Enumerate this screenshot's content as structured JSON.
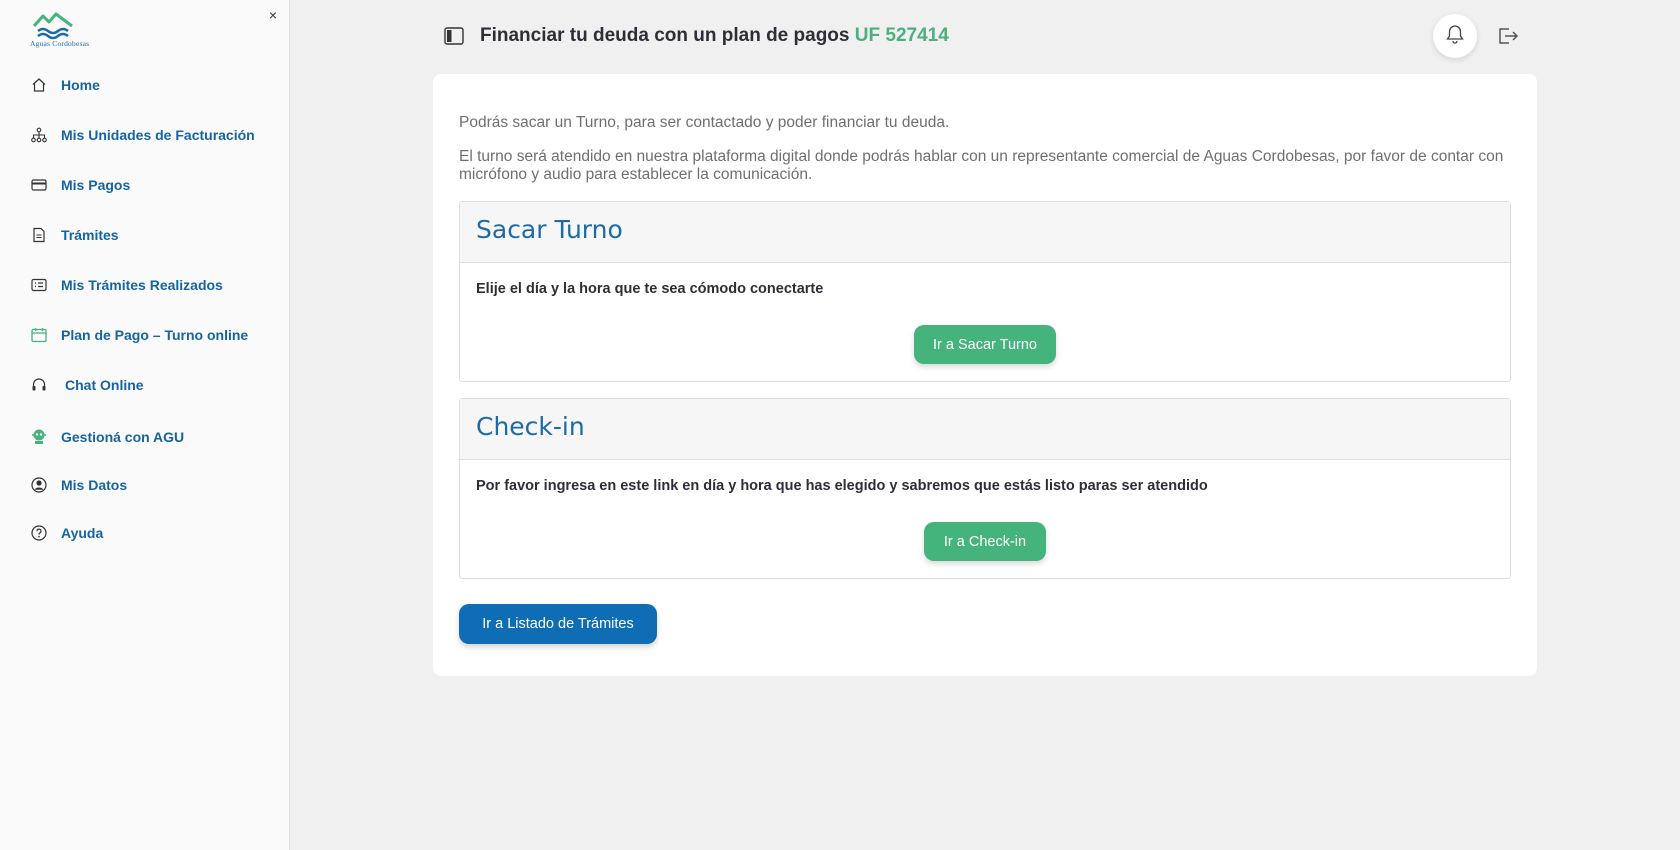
{
  "brand": {
    "logo_text": "Aguas Cordobesas",
    "accent": "#4caf7c",
    "primary": "#1665a0"
  },
  "sidebar": {
    "close_label": "×",
    "items": [
      {
        "label": "Home",
        "icon": "home-icon"
      },
      {
        "label": "Mis Unidades de Facturación",
        "icon": "sitemap-icon"
      },
      {
        "label": "Mis Pagos",
        "icon": "credit-card-icon"
      },
      {
        "label": "Trámites",
        "icon": "document-icon"
      },
      {
        "label": "Mis Trámites Realizados",
        "icon": "list-card-icon"
      },
      {
        "label": "Plan de Pago – Turno online",
        "icon": "calendar-icon"
      },
      {
        "label": "Chat Online",
        "icon": "headset-icon"
      },
      {
        "label": "Gestioná con AGU",
        "icon": "robot-icon"
      },
      {
        "label": "Mis Datos",
        "icon": "user-circle-icon"
      },
      {
        "label": "Ayuda",
        "icon": "help-circle-icon"
      }
    ]
  },
  "header": {
    "title": "Financiar tu deuda con un plan de pagos",
    "uf": "UF 527414"
  },
  "main": {
    "intro1": "Podrás sacar un Turno, para ser contactado y poder financiar tu deuda.",
    "intro2": "El turno será atendido en nuestra plataforma digital donde podrás hablar con un representante comercial de Aguas Cordobesas, por favor de contar con micrófono y audio para establecer la comunicación.",
    "panels": [
      {
        "title": "Sacar Turno",
        "text": "Elije el día y la hora que te sea cómodo conectarte",
        "button": "Ir a Sacar Turno"
      },
      {
        "title": "Check-in",
        "text": "Por favor ingresa en este link en día y hora que has elegido y sabremos que estás listo paras ser atendido",
        "button": "Ir a Check-in"
      }
    ],
    "list_button": "Ir a Listado de Trámites"
  }
}
